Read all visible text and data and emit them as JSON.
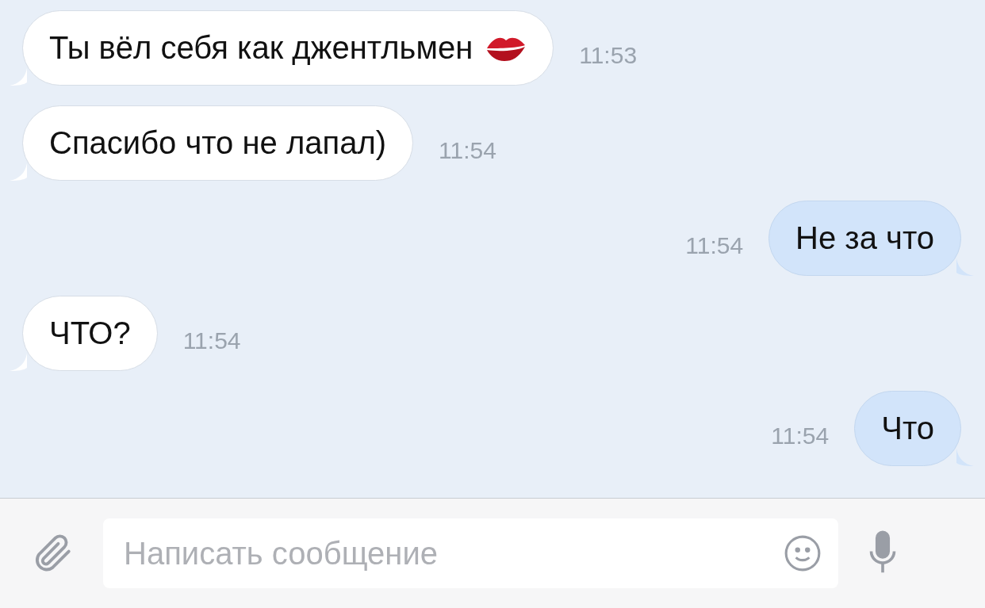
{
  "messages": [
    {
      "kind": "incoming",
      "text": "Ты вёл себя как джентльмен",
      "emoji": true,
      "time": "11:53"
    },
    {
      "kind": "incoming",
      "text": "Спасибо что не лапал)",
      "time": "11:54"
    },
    {
      "kind": "outgoing",
      "text": "Не за что",
      "time": "11:54"
    },
    {
      "kind": "incoming",
      "text": "ЧТО?",
      "time": "11:54"
    },
    {
      "kind": "outgoing",
      "text": "Что",
      "time": "11:54"
    }
  ],
  "composer": {
    "placeholder": "Написать сообщение"
  }
}
